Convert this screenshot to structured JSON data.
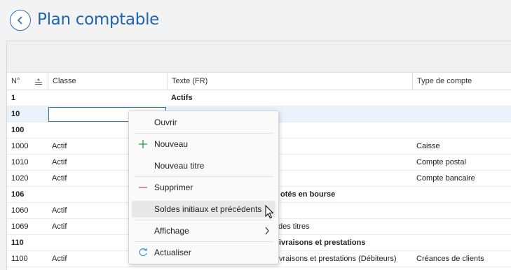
{
  "header": {
    "title": "Plan comptable"
  },
  "columns": [
    "N°",
    "Classe",
    "Texte (FR)",
    "Type de compte"
  ],
  "rows": [
    {
      "no": "1",
      "classe": "",
      "texte": "Actifs",
      "type": ""
    },
    {
      "no": "10",
      "classe": "",
      "texte": "",
      "type": ""
    },
    {
      "no": "100",
      "classe": "",
      "texte": "",
      "type": ""
    },
    {
      "no": "1000",
      "classe": "Actif",
      "texte": "",
      "type": "Caisse"
    },
    {
      "no": "1010",
      "classe": "Actif",
      "texte": "",
      "type": "Compte postal"
    },
    {
      "no": "1020",
      "classe": "Actif",
      "texte": "",
      "type": "Compte bancaire"
    },
    {
      "no": "106",
      "classe": "",
      "texte": "otés en bourse",
      "type": ""
    },
    {
      "no": "1060",
      "classe": "Actif",
      "texte": "",
      "type": ""
    },
    {
      "no": "1069",
      "classe": "Actif",
      "texte": "des titres",
      "type": ""
    },
    {
      "no": "110",
      "classe": "",
      "texte": "ivraisons et prestations",
      "type": ""
    },
    {
      "no": "1100",
      "classe": "Actif",
      "texte": "vraisons et prestations (Débiteurs)",
      "type": "Créances de clients"
    }
  ],
  "menu": {
    "open": "Ouvrir",
    "new": "Nouveau",
    "new_title": "Nouveau titre",
    "delete": "Supprimer",
    "balances": "Soldes initiaux et précédents",
    "display": "Affichage",
    "refresh": "Actualiser"
  },
  "colors": {
    "accent": "#1e66b0",
    "add": "#2e9e4f",
    "delete": "#d9534f"
  }
}
